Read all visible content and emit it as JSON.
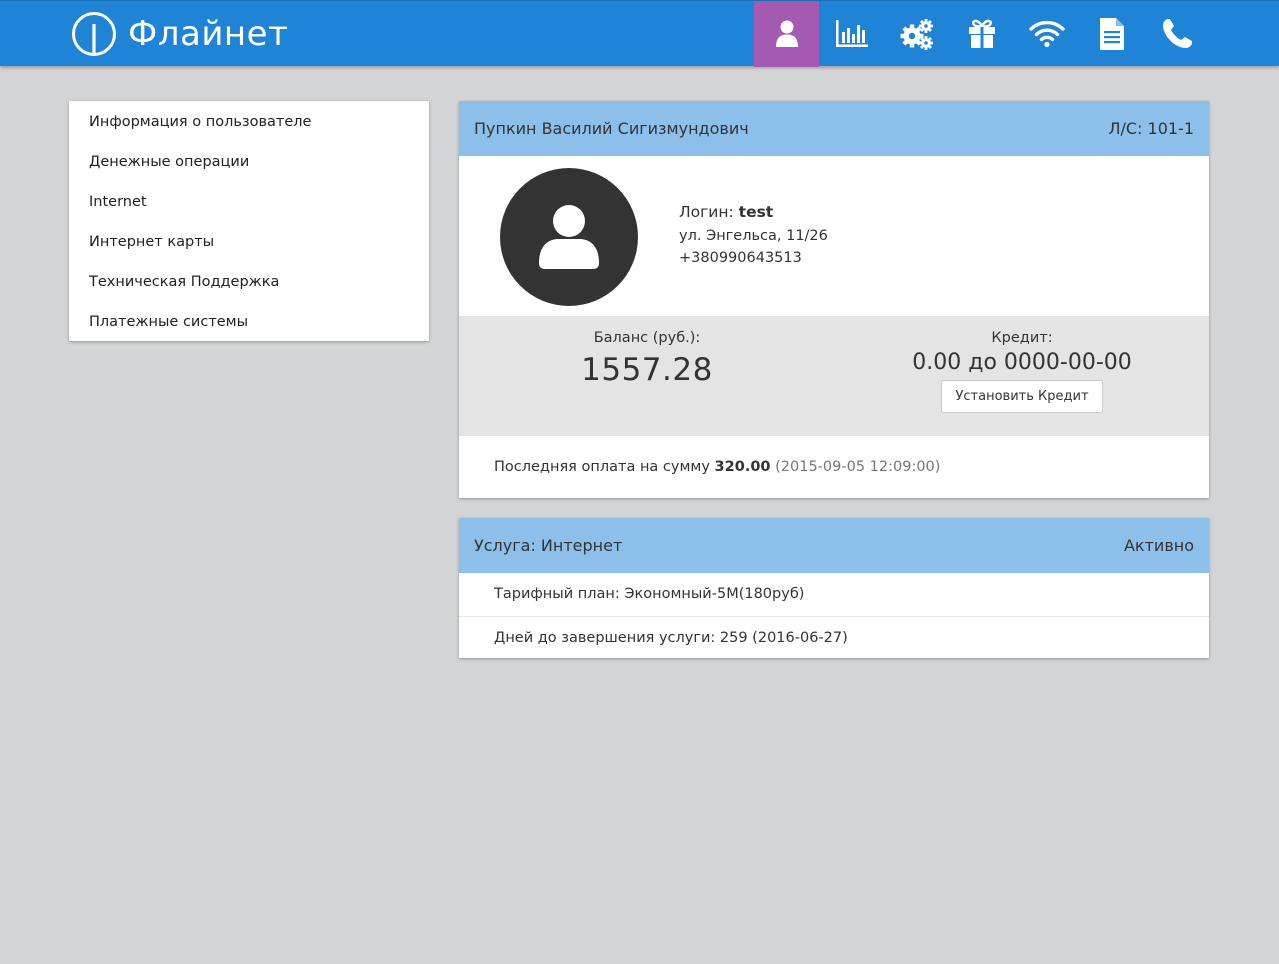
{
  "header": {
    "brand_name": "Флайнет",
    "bg_color": "#1f84d6",
    "active_color": "#a35ab0",
    "nav_icons": [
      "user-icon",
      "bar-chart-icon",
      "gears-icon",
      "gift-icon",
      "wifi-icon",
      "document-icon",
      "phone-icon"
    ]
  },
  "sidebar": {
    "items": [
      {
        "label": "Информация о пользователе"
      },
      {
        "label": "Денежные операции"
      },
      {
        "label": "Internet"
      },
      {
        "label": "Интернет карты"
      },
      {
        "label": "Техническая Поддержка"
      },
      {
        "label": "Платежные системы"
      }
    ]
  },
  "user_card": {
    "full_name": "Пупкин Василий Сигизмундович",
    "account": "Л/С: 101-1",
    "login_label": "Логин:",
    "login_value": "test",
    "address": "ул. Энгельса, 11/26",
    "phone": "+380990643513",
    "balance_label": "Баланс (руб.):",
    "balance_value": "1557.28",
    "credit_label": "Кредит:",
    "credit_value": "0.00 до 0000-00-00",
    "credit_button": "Установить Кредит",
    "last_payment_prefix": "Последняя оплата на сумму",
    "last_payment_amount": "320.00",
    "last_payment_date": "(2015-09-05 12:09:00)"
  },
  "service_card": {
    "title": "Услуга: Интернет",
    "status": "Активно",
    "tariff": "Тарифный план: Экономный-5М(180руб)",
    "days_left": "Дней до завершения услуги: 259 (2016-06-27)"
  }
}
